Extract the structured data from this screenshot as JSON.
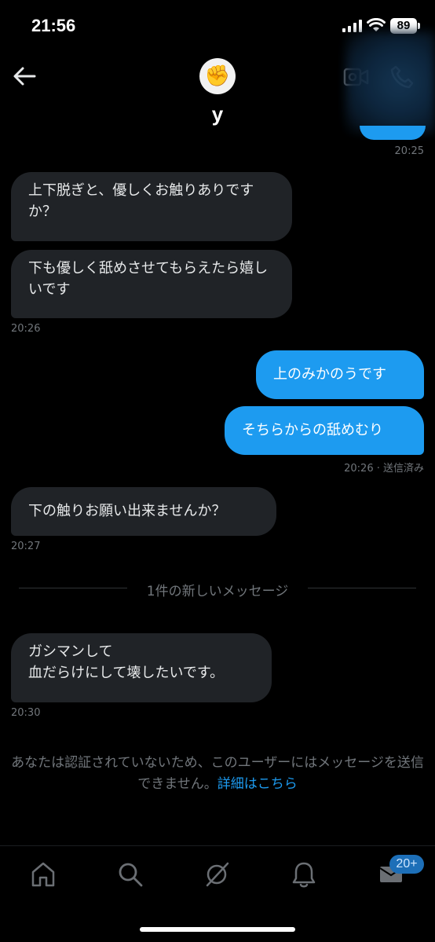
{
  "status_bar": {
    "time": "21:56",
    "battery": "89"
  },
  "header": {
    "contact_name": "y",
    "avatar_emoji": "✊"
  },
  "messages": [
    {
      "direction": "received",
      "text": "上下脱ぎと、優しくお触りありですか？"
    },
    {
      "direction": "received",
      "text": "下も優しく舐めさせてもらえたら嬉しいです",
      "timestamp": "20:26"
    },
    {
      "direction": "sent",
      "text": "上のみかのうです"
    },
    {
      "direction": "sent",
      "text": "そちらからの舐めむり",
      "timestamp": "20:26 · 送信済み"
    },
    {
      "direction": "received",
      "text": "下の触りお願い出来ませんか？",
      "timestamp": "20:27"
    },
    {
      "direction": "received",
      "text": "ガシマンして\n血だらけにして壊したいです。",
      "timestamp": "20:30"
    }
  ],
  "top_partial_timestamp": "20:25",
  "new_messages_divider": "1件の新しいメッセージ",
  "notice": {
    "text": "あなたは認証されていないため、このユーザーにはメッセージを送信できません。",
    "link": "詳細はこちら"
  },
  "tabbar": {
    "items": [
      "home-icon",
      "search-icon",
      "grok-icon",
      "notifications-icon",
      "messages-icon"
    ],
    "messages_badge": "20+"
  },
  "colors": {
    "accent": "#1d9bf0",
    "received_bubble": "#202327",
    "muted_text": "#71767b",
    "background": "#000000"
  }
}
